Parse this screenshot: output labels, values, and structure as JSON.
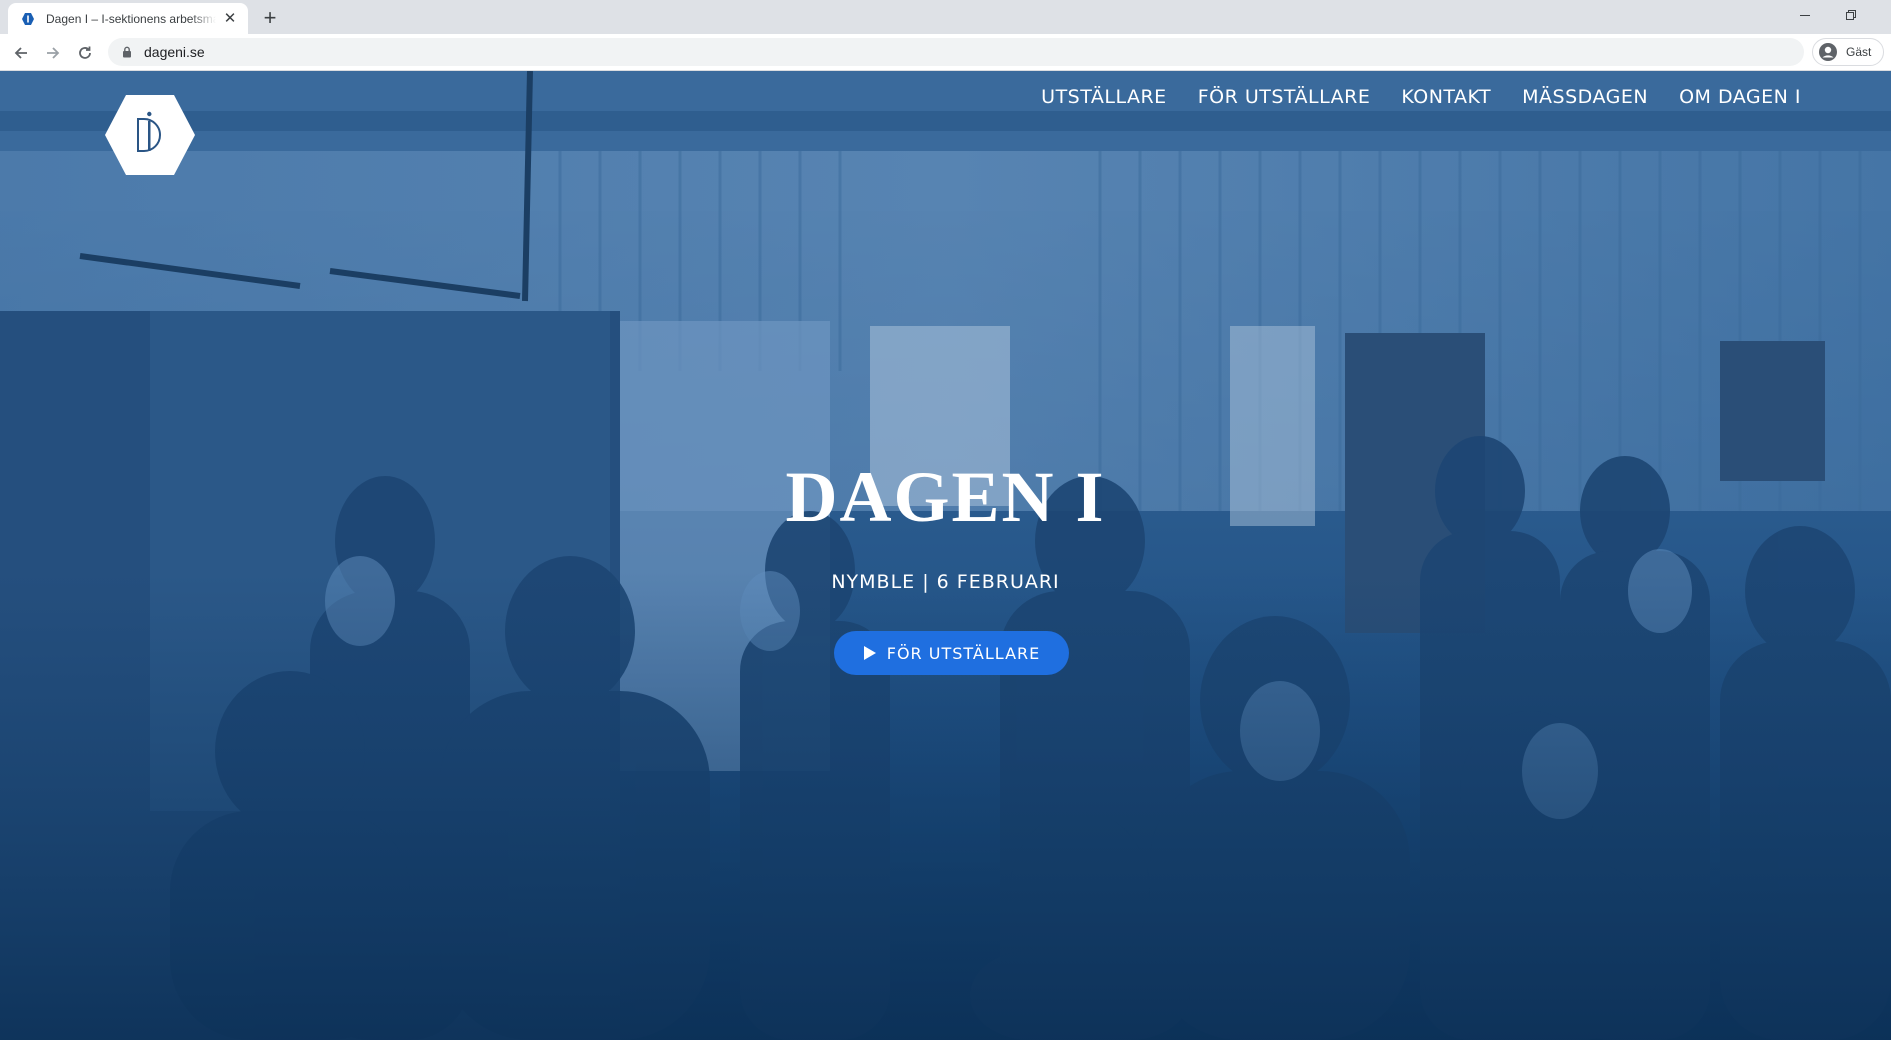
{
  "browser": {
    "tab": {
      "title": "Dagen I – I-sektionens arbetsmarknadsdag",
      "favicon": "hexagon-logo-icon",
      "close_icon": "close-icon"
    },
    "new_tab_icon": "plus-icon",
    "window_controls": [
      "minimize-icon",
      "restore-icon"
    ],
    "url": "dageni.se",
    "profile_label": "Gäst"
  },
  "site": {
    "nav": [
      {
        "label": "UTSTÄLLARE"
      },
      {
        "label": "FÖR UTSTÄLLARE"
      },
      {
        "label": "KONTAKT"
      },
      {
        "label": "MÄSSDAGEN"
      },
      {
        "label": "OM DAGEN I"
      }
    ],
    "hero": {
      "title": "DAGEN I",
      "subtitle": "NYMBLE | 6 FEBRUARI",
      "cta_label": "FÖR UTSTÄLLARE"
    }
  },
  "colors": {
    "hero_overlay": "#2e5f92",
    "cta_background": "#1f6fe0",
    "nav_text": "#ffffff",
    "tabbar": "#dee1e6"
  }
}
